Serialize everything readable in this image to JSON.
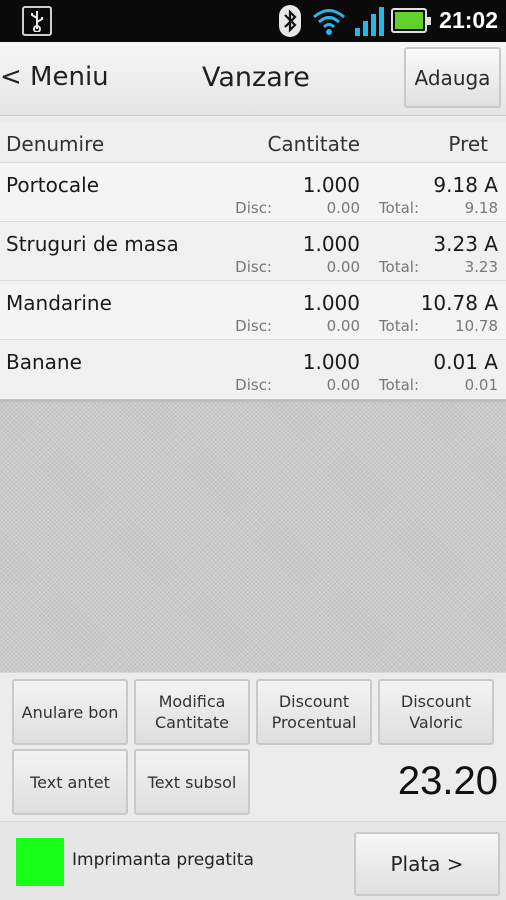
{
  "status_bar": {
    "time": "21:02",
    "icons": [
      "usb-icon",
      "bluetooth-icon",
      "wifi-icon",
      "signal-icon",
      "battery-charging-icon"
    ],
    "battery_color": "#5fd12a"
  },
  "header": {
    "back_label": "< Meniu",
    "title": "Vanzare",
    "add_label": "Adauga"
  },
  "table": {
    "columns": [
      "Denumire",
      "Cantitate",
      "Pret"
    ],
    "rows": [
      {
        "name": "Portocale",
        "qty": "1.000",
        "price": "9.18 A",
        "disc_label": "Disc:",
        "disc": "0.00",
        "total_label": "Total:",
        "total": "9.18"
      },
      {
        "name": "Struguri de masa",
        "qty": "1.000",
        "price": "3.23 A",
        "disc_label": "Disc:",
        "disc": "0.00",
        "total_label": "Total:",
        "total": "3.23"
      },
      {
        "name": "Mandarine",
        "qty": "1.000",
        "price": "10.78 A",
        "disc_label": "Disc:",
        "disc": "0.00",
        "total_label": "Total:",
        "total": "10.78"
      },
      {
        "name": "Banane",
        "qty": "1.000",
        "price": "0.01 A",
        "disc_label": "Disc:",
        "disc": "0.00",
        "total_label": "Total:",
        "total": "0.01"
      }
    ]
  },
  "actions": {
    "cancel_receipt": "Anulare bon",
    "modify_quantity": "Modifica\nCantitate",
    "discount_percent": "Discount\nProcentual",
    "discount_value": "Discount\nValoric",
    "header_text": "Text antet",
    "footer_text": "Text subsol"
  },
  "total": "23.20",
  "footer": {
    "printer_status": "Imprimanta pregatita",
    "printer_color": "#16ff16",
    "pay_label": "Plata >"
  }
}
